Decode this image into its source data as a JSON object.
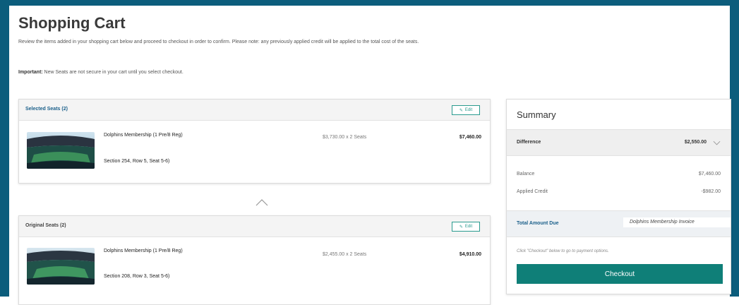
{
  "page": {
    "title": "Shopping Cart",
    "intro": "Review the items added in your shopping cart below and proceed to checkout in order to confirm. Please note: any previously applied credit will be applied to the total cost of the seats.",
    "important_label": "Important:",
    "important_text": " New Seats are not secure in your cart until you select checkout."
  },
  "selected": {
    "title": "Selected Seats (2)",
    "edit_label": "Edit",
    "item": {
      "name": "Dolphins Membership (1 Pre/8 Reg)",
      "seat": "Section 254, Row 5, Seat 5-6)",
      "price": "$3,730.00 x 2 Seats",
      "total": "$7,460.00"
    }
  },
  "original": {
    "title": "Original Seats (2)",
    "edit_label": "Edit",
    "item": {
      "name": "Dolphins Membership (1 Pre/8 Reg)",
      "seat": "Section 208, Row 3, Seat 5-6)",
      "price": "$2,455.00 x 2 Seats",
      "total": "$4,910.00"
    }
  },
  "summary": {
    "title": "Summary",
    "difference_label": "Difference",
    "difference_value": "$2,550.00",
    "balance_label": "Balance",
    "balance_value": "$7,460.00",
    "credit_label": "Applied Credit",
    "credit_value": "-$982.00",
    "total_label": "Total Amount Due",
    "total_value": "Dolphins Membership Invoice",
    "note": "Click \"Checkout\" below to go to payment options.",
    "checkout_label": "Checkout"
  },
  "colors": {
    "frame": "#0c5d7c",
    "accent": "#0f7f78",
    "link": "#1a5f8a"
  }
}
